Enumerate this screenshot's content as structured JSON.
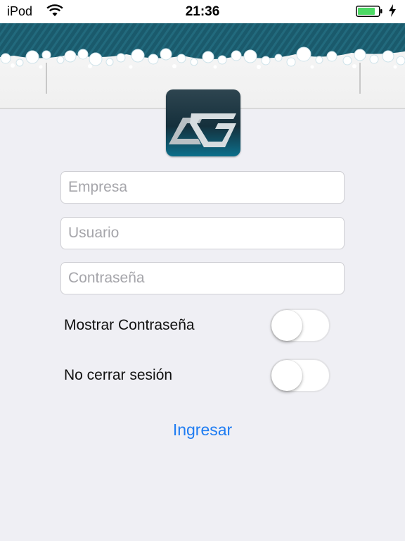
{
  "status_bar": {
    "carrier": "iPod",
    "time": "21:36",
    "wifi_icon": "wifi-icon",
    "battery_icon": "battery-icon",
    "charging_icon": "bolt-icon",
    "battery_color": "#4cd964"
  },
  "header": {
    "banner_color": "#1a5a6c"
  },
  "logo": {
    "icon": "ag-logo-icon"
  },
  "form": {
    "company": {
      "placeholder": "Empresa",
      "value": ""
    },
    "user": {
      "placeholder": "Usuario",
      "value": ""
    },
    "password": {
      "placeholder": "Contraseña",
      "value": ""
    },
    "show_password": {
      "label": "Mostrar Contraseña",
      "on": false
    },
    "stay_logged_in": {
      "label": "No cerrar sesión",
      "on": false
    },
    "submit_label": "Ingresar"
  },
  "colors": {
    "background": "#efeff4",
    "link_blue": "#1e7cf2"
  }
}
